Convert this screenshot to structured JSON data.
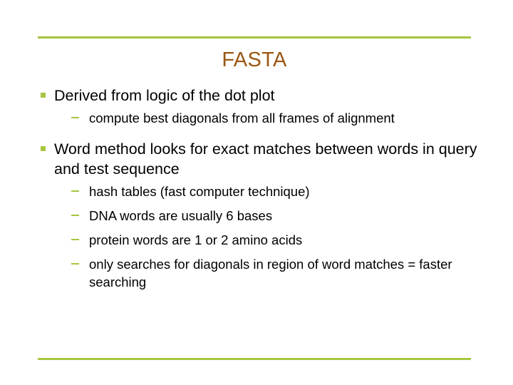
{
  "slide": {
    "title": "FASTA",
    "title_color": "#9A5713",
    "rule_color": "#A7C63F",
    "bullet_color": "#A7C63F",
    "text_color": "#000000",
    "background": "#FFFFFF",
    "bullets": [
      {
        "level1_text": "Derived from logic of the dot plot",
        "bullet_icon": "square-bullet-icon",
        "sub": [
          {
            "text": "compute best diagonals from all frames of alignment",
            "bullet_icon": "dash-bullet-icon"
          }
        ]
      },
      {
        "level1_text": "Word method looks for exact matches between words in query and test sequence",
        "bullet_icon": "square-bullet-icon",
        "sub": [
          {
            "text": "hash tables (fast computer technique)",
            "bullet_icon": "dash-bullet-icon"
          },
          {
            "text": "DNA words are usually 6 bases",
            "bullet_icon": "dash-bullet-icon"
          },
          {
            "text": "protein words are 1 or 2 amino acids",
            "bullet_icon": "dash-bullet-icon"
          },
          {
            "text": "only searches for diagonals in region of word matches = faster searching",
            "bullet_icon": "dash-bullet-icon"
          }
        ]
      }
    ]
  }
}
